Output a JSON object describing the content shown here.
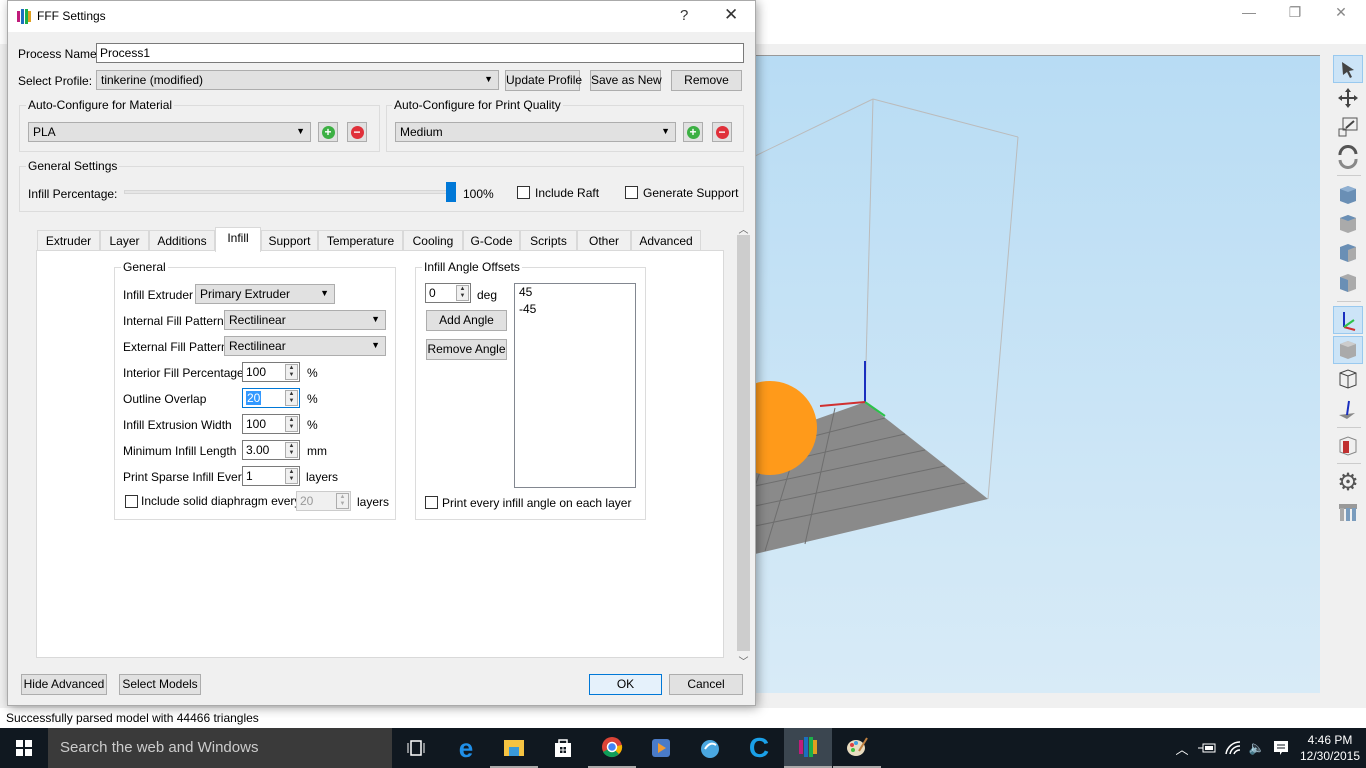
{
  "app": {
    "window_controls": {
      "minimize": "—",
      "restore": "❐",
      "close": "✕"
    },
    "status_text": "Successfully parsed model with 44466 triangles",
    "toolbar_tools": [
      {
        "name": "select-tool",
        "active": true
      },
      {
        "name": "move-tool",
        "active": false
      },
      {
        "name": "scale-tool",
        "active": false
      },
      {
        "name": "rotate-tool",
        "active": false
      },
      {
        "name": "view-iso",
        "active": false
      },
      {
        "name": "view-front",
        "active": false
      },
      {
        "name": "view-top",
        "active": false
      },
      {
        "name": "view-side",
        "active": false
      },
      {
        "name": "axes-toggle",
        "active": true
      },
      {
        "name": "solid-view",
        "active": true
      },
      {
        "name": "wireframe-view",
        "active": false
      },
      {
        "name": "normal-view",
        "active": false
      },
      {
        "name": "cross-section",
        "active": false
      },
      {
        "name": "settings",
        "active": false
      },
      {
        "name": "print-models",
        "active": false
      }
    ]
  },
  "dialog": {
    "title": "FFF Settings",
    "help": "?",
    "close": "✕",
    "process_name_label": "Process Name:",
    "process_name_value": "Process1",
    "select_profile_label": "Select Profile:",
    "select_profile_value": "tinkerine (modified)",
    "update_profile": "Update Profile",
    "save_as_new": "Save as New",
    "remove": "Remove",
    "material_group": "Auto-Configure for Material",
    "material_value": "PLA",
    "quality_group": "Auto-Configure for Print Quality",
    "quality_value": "Medium",
    "general_group": "General Settings",
    "infill_percentage_label": "Infill Percentage:",
    "infill_percentage_value": "100%",
    "infill_percentage_fraction": 1.0,
    "include_raft": "Include Raft",
    "include_raft_checked": false,
    "generate_support": "Generate Support",
    "generate_support_checked": false,
    "tabs": [
      "Extruder",
      "Layer",
      "Additions",
      "Infill",
      "Support",
      "Temperature",
      "Cooling",
      "G-Code",
      "Scripts",
      "Other",
      "Advanced"
    ],
    "active_tab": "Infill",
    "infill": {
      "general_group": "General",
      "infill_extruder_label": "Infill Extruder",
      "infill_extruder_value": "Primary Extruder",
      "internal_fill_label": "Internal Fill Pattern",
      "internal_fill_value": "Rectilinear",
      "external_fill_label": "External Fill Pattern",
      "external_fill_value": "Rectilinear",
      "interior_fill_label": "Interior Fill Percentage",
      "interior_fill_value": "100",
      "interior_fill_unit": "%",
      "outline_overlap_label": "Outline Overlap",
      "outline_overlap_value": "20",
      "outline_overlap_unit": "%",
      "extrusion_width_label": "Infill Extrusion Width",
      "extrusion_width_value": "100",
      "extrusion_width_unit": "%",
      "min_length_label": "Minimum Infill Length",
      "min_length_value": "3.00",
      "min_length_unit": "mm",
      "sparse_label": "Print Sparse Infill Every",
      "sparse_value": "1",
      "sparse_unit": "layers",
      "diaphragm_label": "Include solid diaphragm every",
      "diaphragm_checked": false,
      "diaphragm_value": "20",
      "diaphragm_unit": "layers",
      "angle_group": "Infill Angle Offsets",
      "angle_value": "0",
      "angle_unit": "deg",
      "add_angle": "Add Angle",
      "remove_angle": "Remove Angle",
      "angles": [
        "45",
        "-45"
      ],
      "print_every_angle": "Print every infill angle on each layer",
      "print_every_angle_checked": false
    },
    "hide_advanced": "Hide Advanced",
    "select_models": "Select Models",
    "ok": "OK",
    "cancel": "Cancel"
  },
  "taskbar": {
    "search_placeholder": "Search the web and Windows",
    "apps": [
      "task-view",
      "edge",
      "file-explorer",
      "store",
      "chrome",
      "media-player",
      "app-bird",
      "app-c",
      "simplify3d",
      "paint"
    ],
    "time": "4:46 PM",
    "date": "12/30/2015"
  },
  "colors": {
    "accent": "#0078d7",
    "add": "#3cb043",
    "remove": "#e0303a",
    "model": "#ff9a1a",
    "bed": "#8a8a8a"
  }
}
